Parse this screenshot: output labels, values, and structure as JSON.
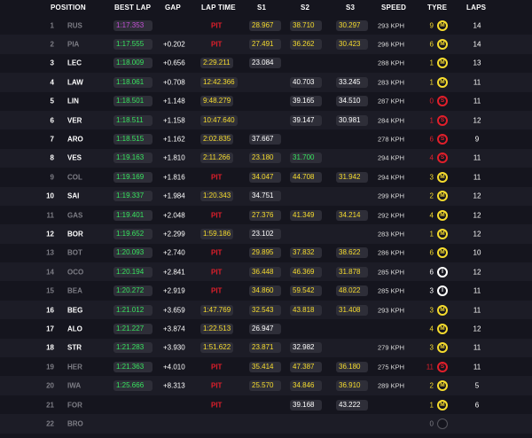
{
  "headers": {
    "position": "POSITION",
    "best_lap": "BEST LAP",
    "gap": "GAP",
    "lap_time": "LAP TIME",
    "s1": "S1",
    "s2": "S2",
    "s3": "S3",
    "speed": "SPEED",
    "tyre": "TYRE",
    "laps": "LAPS"
  },
  "colors": {
    "background": "#15151e",
    "personal_best_green": "#38e45f",
    "yellow": "#f6dc2e",
    "overall_best_purple": "#c451d6",
    "pit_red": "#e11f2b"
  },
  "rows": [
    {
      "pos": "1",
      "code": "RUS",
      "best_lap": "1:17.353",
      "best_lap_color": "p",
      "gap": "",
      "lap_time": "PIT",
      "s1": "28.967",
      "s1_color": "y",
      "s2": "38.710",
      "s2_color": "y",
      "s3": "30.297",
      "s3_color": "y",
      "speed": "293 KPH",
      "tyre_laps": "9",
      "tyre_laps_color": "y",
      "tyre": "M",
      "laps": "14",
      "dim": true
    },
    {
      "pos": "2",
      "code": "PIA",
      "best_lap": "1:17.555",
      "best_lap_color": "g",
      "gap": "+0.202",
      "lap_time": "PIT",
      "s1": "27.491",
      "s1_color": "y",
      "s2": "36.262",
      "s2_color": "y",
      "s3": "30.423",
      "s3_color": "y",
      "speed": "296 KPH",
      "tyre_laps": "6",
      "tyre_laps_color": "y",
      "tyre": "M",
      "laps": "14",
      "dim": true
    },
    {
      "pos": "3",
      "code": "LEC",
      "best_lap": "1:18.009",
      "best_lap_color": "g",
      "gap": "+0.656",
      "lap_time": "2:29.211",
      "s1": "23.084",
      "s1_color": "w",
      "s2": "",
      "s2_color": "",
      "s3": "",
      "s3_color": "",
      "speed": "288 KPH",
      "tyre_laps": "1",
      "tyre_laps_color": "y",
      "tyre": "M",
      "laps": "13",
      "dim": false
    },
    {
      "pos": "4",
      "code": "LAW",
      "best_lap": "1:18.061",
      "best_lap_color": "g",
      "gap": "+0.708",
      "lap_time": "12:42.366",
      "s1": "",
      "s1_color": "",
      "s2": "40.703",
      "s2_color": "w",
      "s3": "33.245",
      "s3_color": "w",
      "speed": "283 KPH",
      "tyre_laps": "1",
      "tyre_laps_color": "y",
      "tyre": "M",
      "laps": "11",
      "dim": false
    },
    {
      "pos": "5",
      "code": "LIN",
      "best_lap": "1:18.501",
      "best_lap_color": "g",
      "gap": "+1.148",
      "lap_time": "9:48.279",
      "s1": "",
      "s1_color": "",
      "s2": "39.165",
      "s2_color": "w",
      "s3": "34.510",
      "s3_color": "w",
      "speed": "287 KPH",
      "tyre_laps": "0",
      "tyre_laps_color": "r",
      "tyre": "S",
      "laps": "11",
      "dim": false
    },
    {
      "pos": "6",
      "code": "VER",
      "best_lap": "1:18.511",
      "best_lap_color": "g",
      "gap": "+1.158",
      "lap_time": "10:47.640",
      "s1": "",
      "s1_color": "",
      "s2": "39.147",
      "s2_color": "w",
      "s3": "30.981",
      "s3_color": "w",
      "speed": "284 KPH",
      "tyre_laps": "1",
      "tyre_laps_color": "r",
      "tyre": "S",
      "laps": "12",
      "dim": false
    },
    {
      "pos": "7",
      "code": "ARO",
      "best_lap": "1:18.515",
      "best_lap_color": "g",
      "gap": "+1.162",
      "lap_time": "2:02.835",
      "s1": "37.667",
      "s1_color": "w",
      "s2": "",
      "s2_color": "",
      "s3": "",
      "s3_color": "",
      "speed": "278 KPH",
      "tyre_laps": "6",
      "tyre_laps_color": "r",
      "tyre": "S",
      "laps": "9",
      "dim": false
    },
    {
      "pos": "8",
      "code": "VES",
      "best_lap": "1:19.163",
      "best_lap_color": "g",
      "gap": "+1.810",
      "lap_time": "2:11.266",
      "s1": "23.180",
      "s1_color": "y",
      "s2": "31.700",
      "s2_color": "g",
      "s3": "",
      "s3_color": "",
      "speed": "294 KPH",
      "tyre_laps": "4",
      "tyre_laps_color": "r",
      "tyre": "S",
      "laps": "11",
      "dim": false
    },
    {
      "pos": "9",
      "code": "COL",
      "best_lap": "1:19.169",
      "best_lap_color": "g",
      "gap": "+1.816",
      "lap_time": "PIT",
      "s1": "34.047",
      "s1_color": "y",
      "s2": "44.708",
      "s2_color": "y",
      "s3": "31.942",
      "s3_color": "y",
      "speed": "294 KPH",
      "tyre_laps": "3",
      "tyre_laps_color": "y",
      "tyre": "M",
      "laps": "11",
      "dim": true
    },
    {
      "pos": "10",
      "code": "SAI",
      "best_lap": "1:19.337",
      "best_lap_color": "g",
      "gap": "+1.984",
      "lap_time": "1:20.343",
      "s1": "34.751",
      "s1_color": "w",
      "s2": "",
      "s2_color": "",
      "s3": "",
      "s3_color": "",
      "speed": "299 KPH",
      "tyre_laps": "2",
      "tyre_laps_color": "y",
      "tyre": "M",
      "laps": "12",
      "dim": false
    },
    {
      "pos": "11",
      "code": "GAS",
      "best_lap": "1:19.401",
      "best_lap_color": "g",
      "gap": "+2.048",
      "lap_time": "PIT",
      "s1": "27.376",
      "s1_color": "y",
      "s2": "41.349",
      "s2_color": "y",
      "s3": "34.214",
      "s3_color": "y",
      "speed": "292 KPH",
      "tyre_laps": "4",
      "tyre_laps_color": "y",
      "tyre": "M",
      "laps": "12",
      "dim": true
    },
    {
      "pos": "12",
      "code": "BOR",
      "best_lap": "1:19.652",
      "best_lap_color": "g",
      "gap": "+2.299",
      "lap_time": "1:59.186",
      "s1": "23.102",
      "s1_color": "w",
      "s2": "",
      "s2_color": "",
      "s3": "",
      "s3_color": "",
      "speed": "283 KPH",
      "tyre_laps": "1",
      "tyre_laps_color": "y",
      "tyre": "M",
      "laps": "12",
      "dim": false
    },
    {
      "pos": "13",
      "code": "BOT",
      "best_lap": "1:20.093",
      "best_lap_color": "g",
      "gap": "+2.740",
      "lap_time": "PIT",
      "s1": "29.895",
      "s1_color": "y",
      "s2": "37.832",
      "s2_color": "y",
      "s3": "38.622",
      "s3_color": "y",
      "speed": "286 KPH",
      "tyre_laps": "6",
      "tyre_laps_color": "y",
      "tyre": "M",
      "laps": "10",
      "dim": true
    },
    {
      "pos": "14",
      "code": "OCO",
      "best_lap": "1:20.194",
      "best_lap_color": "g",
      "gap": "+2.841",
      "lap_time": "PIT",
      "s1": "36.448",
      "s1_color": "y",
      "s2": "46.369",
      "s2_color": "y",
      "s3": "31.878",
      "s3_color": "y",
      "speed": "285 KPH",
      "tyre_laps": "6",
      "tyre_laps_color": "w",
      "tyre": "I",
      "laps": "12",
      "dim": true
    },
    {
      "pos": "15",
      "code": "BEA",
      "best_lap": "1:20.272",
      "best_lap_color": "g",
      "gap": "+2.919",
      "lap_time": "PIT",
      "s1": "34.860",
      "s1_color": "y",
      "s2": "59.542",
      "s2_color": "y",
      "s3": "48.022",
      "s3_color": "y",
      "speed": "285 KPH",
      "tyre_laps": "3",
      "tyre_laps_color": "w",
      "tyre": "I",
      "laps": "11",
      "dim": true
    },
    {
      "pos": "16",
      "code": "BEG",
      "best_lap": "1:21.012",
      "best_lap_color": "g",
      "gap": "+3.659",
      "lap_time": "1:47.769",
      "s1": "32.543",
      "s1_color": "y",
      "s2": "43.818",
      "s2_color": "y",
      "s3": "31.408",
      "s3_color": "y",
      "speed": "293 KPH",
      "tyre_laps": "3",
      "tyre_laps_color": "y",
      "tyre": "M",
      "laps": "11",
      "dim": false
    },
    {
      "pos": "17",
      "code": "ALO",
      "best_lap": "1:21.227",
      "best_lap_color": "g",
      "gap": "+3.874",
      "lap_time": "1:22.513",
      "s1": "26.947",
      "s1_color": "w",
      "s2": "",
      "s2_color": "",
      "s3": "",
      "s3_color": "",
      "speed": "",
      "tyre_laps": "4",
      "tyre_laps_color": "y",
      "tyre": "M",
      "laps": "12",
      "dim": false
    },
    {
      "pos": "18",
      "code": "STR",
      "best_lap": "1:21.283",
      "best_lap_color": "g",
      "gap": "+3.930",
      "lap_time": "1:51.622",
      "s1": "23.871",
      "s1_color": "y",
      "s2": "32.982",
      "s2_color": "w",
      "s3": "",
      "s3_color": "",
      "speed": "279 KPH",
      "tyre_laps": "3",
      "tyre_laps_color": "y",
      "tyre": "M",
      "laps": "11",
      "dim": false
    },
    {
      "pos": "19",
      "code": "HER",
      "best_lap": "1:21.363",
      "best_lap_color": "g",
      "gap": "+4.010",
      "lap_time": "PIT",
      "s1": "35.414",
      "s1_color": "y",
      "s2": "47.387",
      "s2_color": "y",
      "s3": "36.180",
      "s3_color": "y",
      "speed": "275 KPH",
      "tyre_laps": "11",
      "tyre_laps_color": "r",
      "tyre": "S",
      "laps": "11",
      "dim": true
    },
    {
      "pos": "20",
      "code": "IWA",
      "best_lap": "1:25.666",
      "best_lap_color": "g",
      "gap": "+8.313",
      "lap_time": "PIT",
      "s1": "25.570",
      "s1_color": "y",
      "s2": "34.846",
      "s2_color": "y",
      "s3": "36.910",
      "s3_color": "y",
      "speed": "289 KPH",
      "tyre_laps": "2",
      "tyre_laps_color": "y",
      "tyre": "M",
      "laps": "5",
      "dim": true
    },
    {
      "pos": "21",
      "code": "FOR",
      "best_lap": "",
      "best_lap_color": "",
      "gap": "",
      "lap_time": "PIT",
      "s1": "",
      "s1_color": "",
      "s2": "39.168",
      "s2_color": "w",
      "s3": "43.222",
      "s3_color": "w",
      "speed": "",
      "tyre_laps": "1",
      "tyre_laps_color": "y",
      "tyre": "M",
      "laps": "6",
      "dim": true
    },
    {
      "pos": "22",
      "code": "BRO",
      "best_lap": "",
      "best_lap_color": "",
      "gap": "",
      "lap_time": "",
      "s1": "",
      "s1_color": "",
      "s2": "",
      "s2_color": "",
      "s3": "",
      "s3_color": "",
      "speed": "",
      "tyre_laps": "0",
      "tyre_laps_color": "g",
      "tyre": "X",
      "laps": "",
      "dim": true
    }
  ]
}
